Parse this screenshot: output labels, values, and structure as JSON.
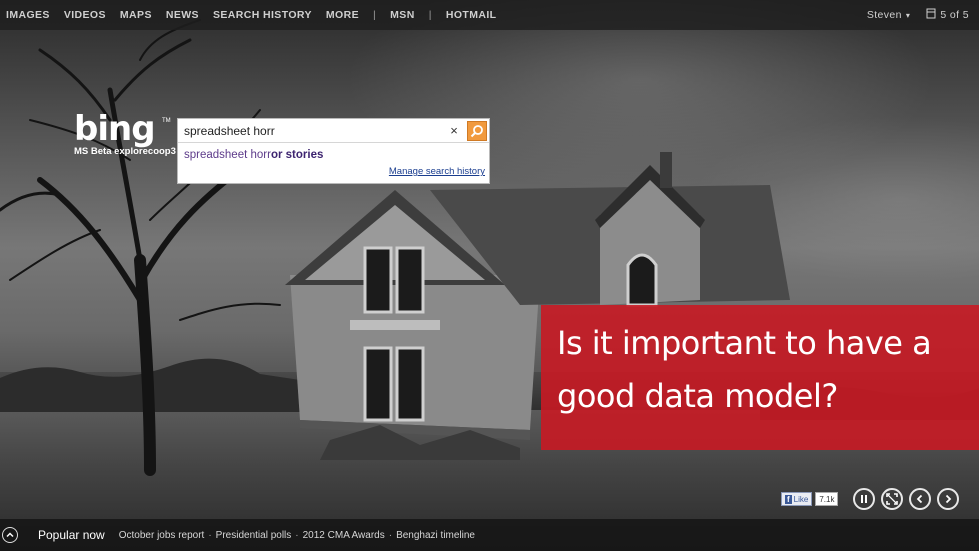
{
  "nav": {
    "links": [
      "IMAGES",
      "VIDEOS",
      "MAPS",
      "NEWS",
      "SEARCH HISTORY",
      "MORE"
    ],
    "separator": "|",
    "external": [
      "MSN",
      "HOTMAIL"
    ],
    "user": "Steven",
    "counter": "5 of 5"
  },
  "logo": {
    "word": "bing",
    "tm": "TM",
    "subtitle": "MS Beta explorecoop3"
  },
  "search": {
    "value": "spreadsheet horr",
    "clear_glyph": "×",
    "suggestion_prefix": "spreadsheet horr",
    "suggestion_rest": "or stories",
    "manage_link": "Manage search history"
  },
  "caption": {
    "line1": "Is it important to have a",
    "line2": "good data model?"
  },
  "facebook": {
    "like_label": "Like",
    "f": "f",
    "count": "7.1k"
  },
  "bottom": {
    "popular_label": "Popular now",
    "news": [
      "October jobs report",
      "Presidential polls",
      "2012 CMA Awards",
      "Benghazi timeline"
    ],
    "separator": "·"
  },
  "colors": {
    "caption_red": "#c81a24",
    "search_orange": "#f19a3e",
    "suggest_purple": "#5d3b8a",
    "link_blue": "#1a3d8f"
  }
}
